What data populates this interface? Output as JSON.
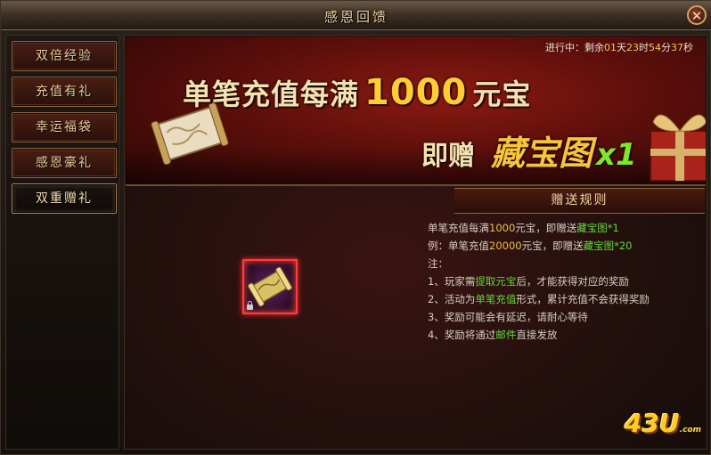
{
  "window": {
    "title": "感恩回馈",
    "close_label": "✕"
  },
  "sidebar": {
    "items": [
      {
        "label": "双倍经验",
        "active": false
      },
      {
        "label": "充值有礼",
        "active": false
      },
      {
        "label": "幸运福袋",
        "active": false
      },
      {
        "label": "感恩豪礼",
        "active": false
      },
      {
        "label": "双重赠礼",
        "active": true
      }
    ]
  },
  "banner": {
    "status_prefix": "进行中：剩余",
    "days": "01",
    "days_unit": "天",
    "hours": "23",
    "hours_unit": "时",
    "minutes": "54",
    "minutes_unit": "分",
    "seconds": "37",
    "seconds_unit": "秒",
    "line1_pre": "单笔充值每满",
    "line1_amount": "1000",
    "line1_post": "元宝",
    "line2_pre": "即赠",
    "line2_item": "藏宝图",
    "line2_count": "x1"
  },
  "rules": {
    "header": "赠送规则",
    "l1_a": "单笔充值每满",
    "l1_num": "1000",
    "l1_b": "元宝，即赠送",
    "l1_item": "藏宝图*1",
    "l2_a": "例：单笔充值",
    "l2_num": "20000",
    "l2_b": "元宝，即赠送",
    "l2_item": "藏宝图*20",
    "note": "注：",
    "r1_a": "1、玩家需",
    "r1_hl": "提取元宝",
    "r1_b": "后，才能获得对应的奖励",
    "r2_a": "2、活动为",
    "r2_hl": "单笔充值",
    "r2_b": "形式，累计充值不会获得奖励",
    "r3": "3、奖励可能会有延迟，请耐心等待",
    "r4_a": "4、奖励将通过",
    "r4_hl": "邮件",
    "r4_b": "直接发放"
  },
  "logo": {
    "main": "43U",
    "sub": ".com"
  },
  "icons": {
    "reward": "treasure-map-icon",
    "lock": "lock-icon",
    "close": "close-icon"
  },
  "colors": {
    "highlight_green": "#63d83c",
    "highlight_yellow": "#f0c040",
    "accent_red": "#ff5a3a"
  }
}
